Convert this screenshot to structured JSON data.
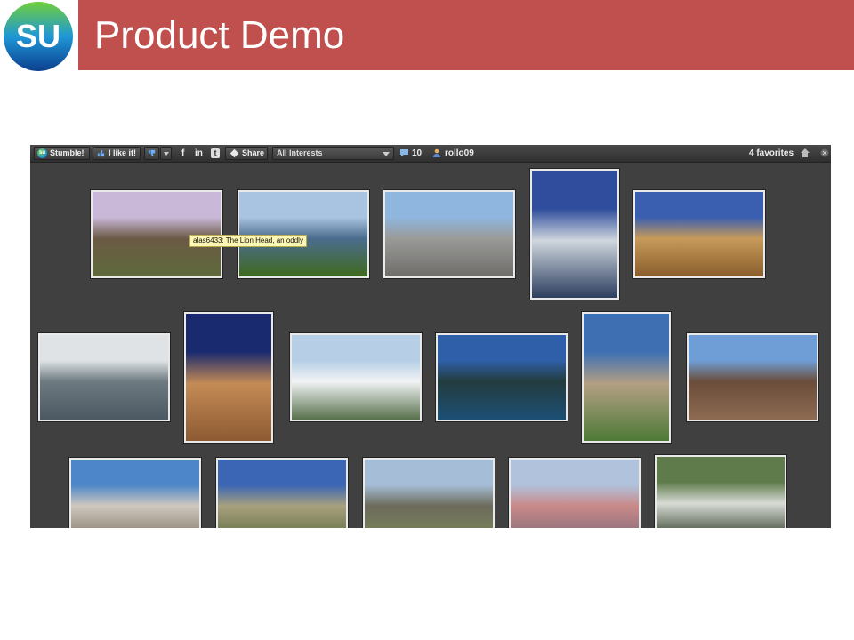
{
  "slide": {
    "title": "Product Demo",
    "logo_text": "SU",
    "accent_color": "#c0504d"
  },
  "toolbar": {
    "stumble_label": "Stumble!",
    "like_label": "I like it!",
    "facebook_glyph": "f",
    "linkedin_glyph": "in",
    "twitter_glyph": "t",
    "share_label": "Share",
    "interest_selected": "All Interests",
    "review_count": "10",
    "username": "rollo09",
    "favorites_label": "4 favorites",
    "icons": [
      "thumb-up-icon",
      "thumb-down-icon",
      "facebook-icon",
      "linkedin-icon",
      "twitter-icon",
      "share-icon",
      "comment-icon",
      "user-icon",
      "home-icon",
      "close-icon"
    ]
  },
  "gallery": {
    "tooltip": "alas6433: The Lion Head, an oddly",
    "photos": [
      {
        "name": "mountain-meadow-sunset",
        "colors": [
          "#c9b8d8",
          "#6b5a45",
          "#5e6a3b"
        ]
      },
      {
        "name": "lion-head-peak",
        "colors": [
          "#a9c4e0",
          "#4b6c8e",
          "#3f6a1e"
        ]
      },
      {
        "name": "granite-basin",
        "colors": [
          "#8fb6de",
          "#9a9a98",
          "#6e6d6a"
        ]
      },
      {
        "name": "alpine-lake-peaks",
        "colors": [
          "#2f4d9c",
          "#cfd6de",
          "#2c3e5f"
        ]
      },
      {
        "name": "desert-cliffs",
        "colors": [
          "#3a5fb0",
          "#c79a5a",
          "#8a5e2c"
        ]
      },
      {
        "name": "snowy-hills",
        "colors": [
          "#dfe3e6",
          "#6d7a80",
          "#4c5862"
        ]
      },
      {
        "name": "canyon-night-sky",
        "colors": [
          "#1a2a6e",
          "#c48b55",
          "#8d5a32"
        ]
      },
      {
        "name": "snowfield-pond",
        "colors": [
          "#b6cfe6",
          "#f1f3f5",
          "#57704b"
        ]
      },
      {
        "name": "still-lake-reflection",
        "colors": [
          "#2f5fa8",
          "#233c3e",
          "#1c4f75"
        ]
      },
      {
        "name": "rock-dome-stream",
        "colors": [
          "#3e6fb3",
          "#b39f84",
          "#4d7a36"
        ]
      },
      {
        "name": "silversword-volcanic",
        "colors": [
          "#6f9ed6",
          "#6a4d3a",
          "#8d6a52"
        ]
      },
      {
        "name": "white-slope-pines",
        "colors": [
          "#4d87c9",
          "#cfc8bf",
          "#7b6f60"
        ]
      },
      {
        "name": "clouds-and-scrub",
        "colors": [
          "#3a66b5",
          "#a8a17e",
          "#58683a"
        ]
      },
      {
        "name": "sagebrush-valley",
        "colors": [
          "#a5bdd6",
          "#6c6a5b",
          "#7d8a5a"
        ]
      },
      {
        "name": "painted-hills",
        "colors": [
          "#b0c2dc",
          "#c98988",
          "#7a6a78"
        ]
      },
      {
        "name": "birch-forest",
        "colors": [
          "#5f7b4c",
          "#d8dcd6",
          "#27351f"
        ]
      }
    ]
  }
}
